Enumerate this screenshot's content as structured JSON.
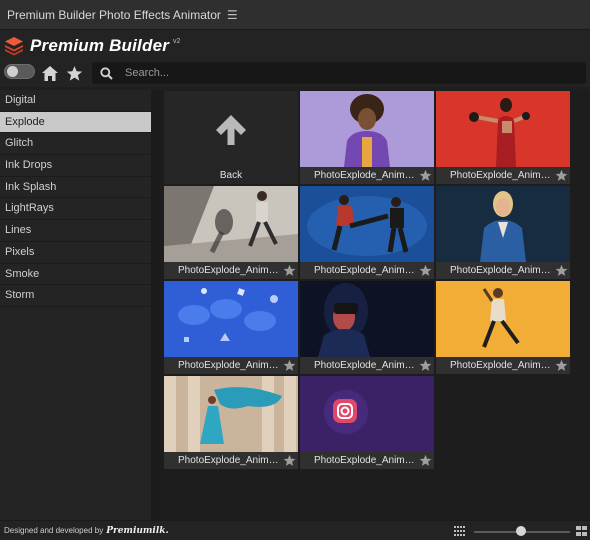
{
  "window": {
    "title": "Premium Builder Photo Effects Animator",
    "menu_icon": "hamburger-icon"
  },
  "brand": {
    "name": "Premium Builder",
    "version": "v2",
    "accent": "#e5452b"
  },
  "toolbar": {
    "toggle_state": "off",
    "search_placeholder": "Search..."
  },
  "sidebar": {
    "items": [
      {
        "label": "Digital",
        "active": false
      },
      {
        "label": "Explode",
        "active": true
      },
      {
        "label": "Glitch",
        "active": false
      },
      {
        "label": "Ink Drops",
        "active": false
      },
      {
        "label": "Ink Splash",
        "active": false
      },
      {
        "label": "LightRays",
        "active": false
      },
      {
        "label": "Lines",
        "active": false
      },
      {
        "label": "Pixels",
        "active": false
      },
      {
        "label": "Smoke",
        "active": false
      },
      {
        "label": "Storm",
        "active": false
      }
    ]
  },
  "grid": {
    "back_label": "Back",
    "tiles": [
      {
        "label": "PhotoExplode_Animat...",
        "favorite": false
      },
      {
        "label": "PhotoExplode_Animat...",
        "favorite": false
      },
      {
        "label": "PhotoExplode_Animat...",
        "favorite": false
      },
      {
        "label": "PhotoExplode_Animat...",
        "favorite": false
      },
      {
        "label": "PhotoExplode_Animat...",
        "favorite": false
      },
      {
        "label": "PhotoExplode_Animat...",
        "favorite": false
      },
      {
        "label": "PhotoExplode_Animat...",
        "favorite": false
      },
      {
        "label": "PhotoExplode_Animat...",
        "favorite": false
      },
      {
        "label": "PhotoExplode_Animat...",
        "favorite": false
      },
      {
        "label": "PhotoExplode_Animat...",
        "favorite": false
      }
    ]
  },
  "footer": {
    "credit": "Designed and developed by",
    "company": "Premiumilk.",
    "thumb_size_fraction": 0.45
  }
}
